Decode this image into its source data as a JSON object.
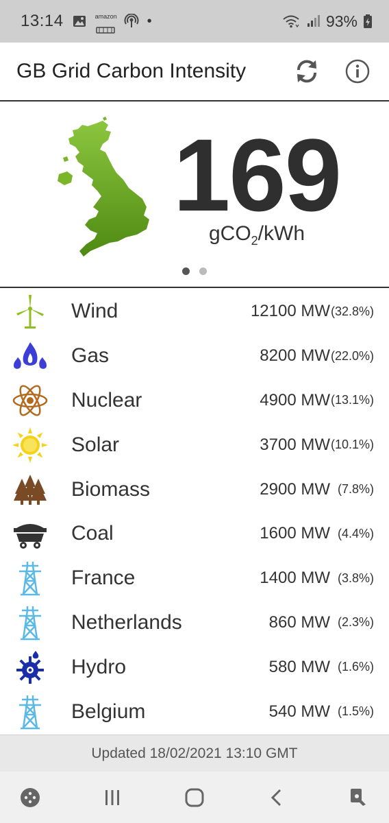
{
  "status_bar": {
    "time": "13:14",
    "battery": "93%",
    "amazon_label": "amazon",
    "icons": [
      "gallery-icon",
      "amazon-icon",
      "podcast-icon",
      "notification-dot",
      "wifi-icon",
      "signal-icon",
      "battery-charging-icon"
    ]
  },
  "app_bar": {
    "title": "GB Grid Carbon Intensity",
    "actions": [
      "refresh-icon",
      "info-icon"
    ]
  },
  "hero": {
    "value": "169",
    "unit_prefix": "gCO",
    "unit_sub": "2",
    "unit_suffix": "/kWh",
    "pages": 2,
    "active_page": 1,
    "map_color": "#6aa624"
  },
  "sources": [
    {
      "name": "Wind",
      "mw": "12100 MW",
      "pct": "(32.8%)",
      "icon": "wind-turbine-icon",
      "color": "#8fbf1f"
    },
    {
      "name": "Gas",
      "mw": "8200 MW",
      "pct": "(22.0%)",
      "icon": "gas-flame-icon",
      "color": "#3b3fd6"
    },
    {
      "name": "Nuclear",
      "mw": "4900 MW",
      "pct": "(13.1%)",
      "icon": "atom-icon",
      "color": "#b36a1e"
    },
    {
      "name": "Solar",
      "mw": "3700 MW",
      "pct": "(10.1%)",
      "icon": "sun-icon",
      "color": "#f4d21a"
    },
    {
      "name": "Biomass",
      "mw": "2900 MW",
      "pct": "(7.8%)",
      "icon": "trees-icon",
      "color": "#7a4a24"
    },
    {
      "name": "Coal",
      "mw": "1600 MW",
      "pct": "(4.4%)",
      "icon": "coal-cart-icon",
      "color": "#333333"
    },
    {
      "name": "France",
      "mw": "1400 MW",
      "pct": "(3.8%)",
      "icon": "pylon-icon",
      "color": "#5ab9e6"
    },
    {
      "name": "Netherlands",
      "mw": "860 MW",
      "pct": "(2.3%)",
      "icon": "pylon-icon",
      "color": "#5ab9e6"
    },
    {
      "name": "Hydro",
      "mw": "580 MW",
      "pct": "(1.6%)",
      "icon": "hydro-wheel-icon",
      "color": "#1a2ea8"
    },
    {
      "name": "Belgium",
      "mw": "540 MW",
      "pct": "(1.5%)",
      "icon": "pylon-icon",
      "color": "#5ab9e6"
    }
  ],
  "footer": {
    "updated": "Updated 18/02/2021 13:10 GMT"
  },
  "nav_bar": {
    "buttons": [
      "game-launcher-icon",
      "recent-apps-icon",
      "home-icon",
      "back-icon",
      "screen-assist-icon"
    ]
  }
}
